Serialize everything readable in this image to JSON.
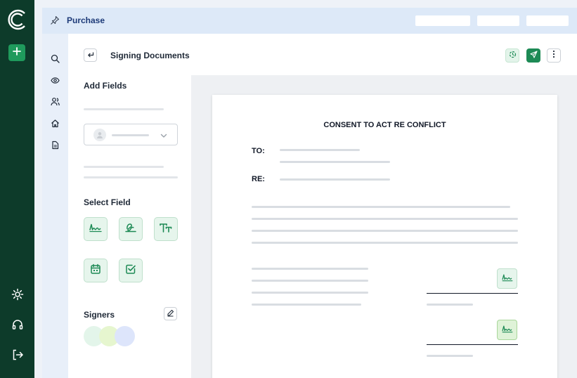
{
  "topbar": {
    "title": "Purchase",
    "pin_icon": "pin-icon"
  },
  "rail": {
    "logo": "brand-logo",
    "add_icon": "plus-icon",
    "bottom_icons": [
      "settings-icon",
      "headset-icon",
      "logout-icon"
    ]
  },
  "nav_icons": [
    "search-icon",
    "eye-icon",
    "users-icon",
    "home-icon",
    "document-icon"
  ],
  "header": {
    "title": "Signing Documents",
    "actions": [
      "history-icon",
      "send-icon",
      "more-icon"
    ]
  },
  "panel": {
    "add_fields_title": "Add Fields",
    "select_field_title": "Select Field",
    "signers_title": "Signers",
    "field_types": [
      "signature-icon",
      "initials-icon",
      "text-icon",
      "date-icon",
      "checkbox-icon"
    ],
    "signer_colors": [
      "#e3f5ea",
      "#e6f6cf",
      "#dde5fb"
    ]
  },
  "document": {
    "heading": "CONSENT TO ACT RE CONFLICT",
    "to_label": "TO:",
    "re_label": "RE:"
  },
  "colors": {
    "rail": "#0d3b2a",
    "accent": "#1d8a55",
    "topbar": "#dde9f8"
  }
}
